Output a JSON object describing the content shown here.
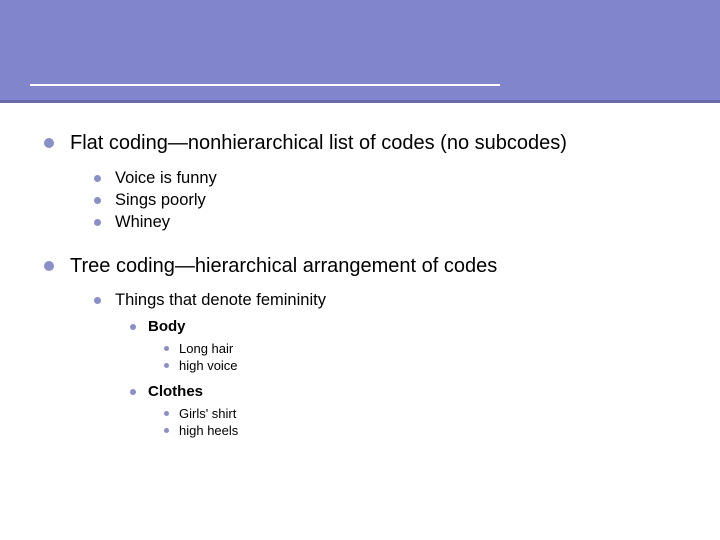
{
  "colors": {
    "band": "#8186cc",
    "bullet": "#8a8fc8"
  },
  "outline": {
    "items": [
      {
        "text": "Flat coding—nonhierarchical list of codes (no subcodes)",
        "children": [
          {
            "text": "Voice is funny"
          },
          {
            "text": "Sings poorly"
          },
          {
            "text": "Whiney"
          }
        ]
      },
      {
        "text": "Tree coding—hierarchical arrangement of codes",
        "children": [
          {
            "text": "Things that denote femininity",
            "children": [
              {
                "text": "Body",
                "children": [
                  {
                    "text": "Long hair"
                  },
                  {
                    "text": "high voice"
                  }
                ]
              },
              {
                "text": "Clothes",
                "children": [
                  {
                    "text": "Girls' shirt"
                  },
                  {
                    "text": "high heels"
                  }
                ]
              }
            ]
          }
        ]
      }
    ]
  }
}
